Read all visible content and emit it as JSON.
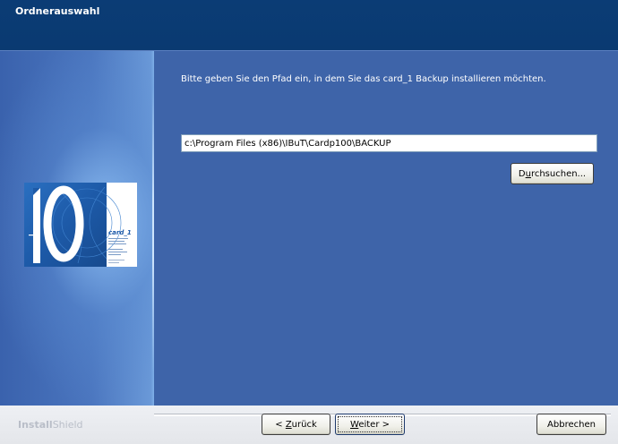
{
  "dialog": {
    "title": "Ordnerauswahl",
    "instruction": "Bitte geben Sie den Pfad ein, in dem Sie das card_1 Backup installieren möchten.",
    "path_value": "c:\\Program Files (x86)\\IBuT\\Cardp100\\BACKUP",
    "browse_label_pre": "D",
    "browse_label_ul": "u",
    "browse_label_post": "rchsuchen...",
    "logo_number": "10",
    "logo_brand": "card_1"
  },
  "footer": {
    "brand_install": "Install",
    "brand_shield": "Shield",
    "back_label_pre": "< ",
    "back_label_ul": "Z",
    "back_label_post": "urück",
    "next_label_ul": "W",
    "next_label_post": "eiter >",
    "cancel_label": "Abbrechen"
  },
  "colors": {
    "header_bg": "#0b3c75",
    "main_bg": "#3e64a9",
    "footer_bg": "#eef0f4"
  }
}
